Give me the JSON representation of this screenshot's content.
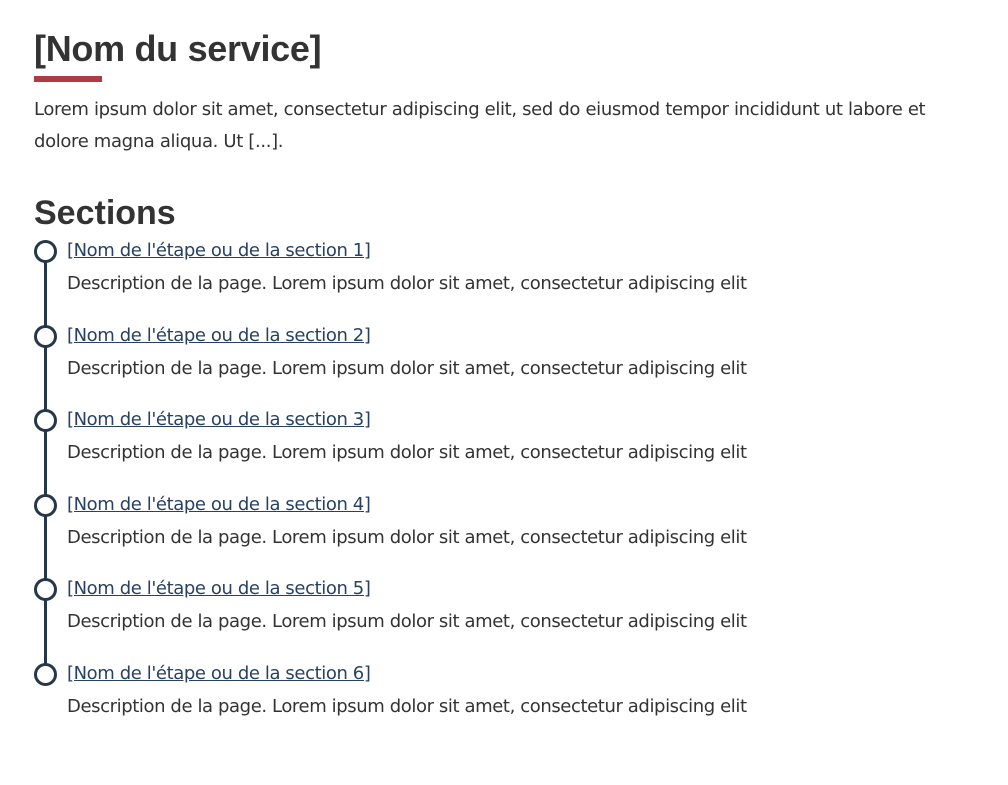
{
  "header": {
    "title": "[Nom du service]",
    "intro": "Lorem ipsum dolor sit amet, consectetur adipiscing elit, sed do eiusmod tempor incididunt ut labore et dolore magna aliqua. Ut [...]."
  },
  "sections": {
    "heading": "Sections",
    "items": [
      {
        "label": "[Nom de l'étape ou de la section 1]",
        "description": "Description de la page. Lorem ipsum dolor sit amet, consectetur adipiscing elit"
      },
      {
        "label": "[Nom de l'étape ou de la section 2]",
        "description": "Description de la page. Lorem ipsum dolor sit amet, consectetur adipiscing elit"
      },
      {
        "label": "[Nom de l'étape ou de la section 3]",
        "description": "Description de la page. Lorem ipsum dolor sit amet, consectetur adipiscing elit"
      },
      {
        "label": "[Nom de l'étape ou de la section 4]",
        "description": "Description de la page. Lorem ipsum dolor sit amet, consectetur adipiscing elit"
      },
      {
        "label": "[Nom de l'étape ou de la section 5]",
        "description": "Description de la page. Lorem ipsum dolor sit amet, consectetur adipiscing elit"
      },
      {
        "label": "[Nom de l'étape ou de la section 6]",
        "description": "Description de la page. Lorem ipsum dolor sit amet, consectetur adipiscing elit"
      }
    ]
  },
  "colors": {
    "accent_underline": "#af3c43",
    "timeline": "#26374a",
    "link": "#284162",
    "text": "#333333"
  }
}
